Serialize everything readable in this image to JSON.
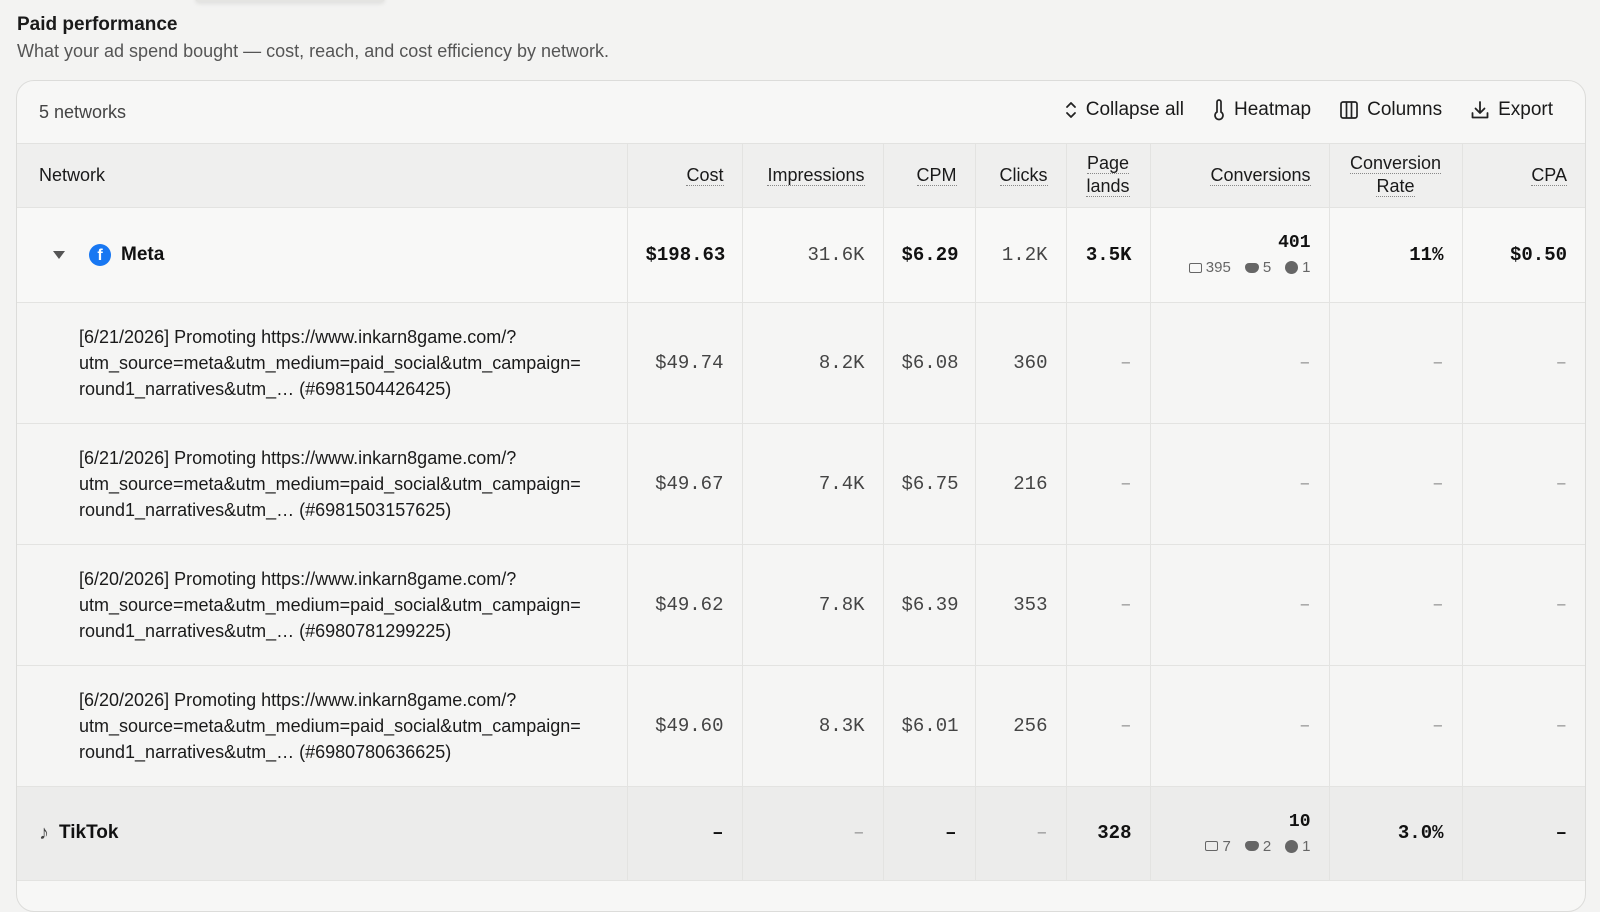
{
  "section": {
    "title": "Paid performance",
    "subtitle": "What your ad spend bought — cost, reach, and cost efficiency by network."
  },
  "toolbar": {
    "count": "5 networks",
    "collapse_label": "Collapse all",
    "heatmap_label": "Heatmap",
    "columns_label": "Columns",
    "export_label": "Export"
  },
  "columns": {
    "network": "Network",
    "cost": "Cost",
    "impressions": "Impressions",
    "cpm": "CPM",
    "clicks": "Clicks",
    "page_lands_1": "Page",
    "page_lands_2": "lands",
    "conversions": "Conversions",
    "conv_rate_1": "Conversion",
    "conv_rate_2": "Rate",
    "cpa": "CPA"
  },
  "meta": {
    "name": "Meta",
    "cost": "$198.63",
    "impressions": "31.6K",
    "cpm": "$6.29",
    "clicks": "1.2K",
    "page_lands": "3.5K",
    "conversions": "401",
    "conv_email": "395",
    "conv_discord": "5",
    "conv_threads": "1",
    "conv_rate": "11%",
    "cpa": "$0.50"
  },
  "campaigns": [
    {
      "line1": "[6/21/2026] Promoting https://www.inkarn8game.com/?",
      "line2": "utm_source=meta&utm_medium=paid_social&utm_campaign=",
      "line3": "round1_narratives&utm_… (#6981504426425)",
      "cost": "$49.74",
      "impressions": "8.2K",
      "cpm": "$6.08",
      "clicks": "360",
      "page_lands": "–",
      "conversions": "–",
      "conv_rate": "–",
      "cpa": "–"
    },
    {
      "line1": "[6/21/2026] Promoting https://www.inkarn8game.com/?",
      "line2": "utm_source=meta&utm_medium=paid_social&utm_campaign=",
      "line3": "round1_narratives&utm_… (#6981503157625)",
      "cost": "$49.67",
      "impressions": "7.4K",
      "cpm": "$6.75",
      "clicks": "216",
      "page_lands": "–",
      "conversions": "–",
      "conv_rate": "–",
      "cpa": "–"
    },
    {
      "line1": "[6/20/2026] Promoting https://www.inkarn8game.com/?",
      "line2": "utm_source=meta&utm_medium=paid_social&utm_campaign=",
      "line3": "round1_narratives&utm_… (#6980781299225)",
      "cost": "$49.62",
      "impressions": "7.8K",
      "cpm": "$6.39",
      "clicks": "353",
      "page_lands": "–",
      "conversions": "–",
      "conv_rate": "–",
      "cpa": "–"
    },
    {
      "line1": "[6/20/2026] Promoting https://www.inkarn8game.com/?",
      "line2": "utm_source=meta&utm_medium=paid_social&utm_campaign=",
      "line3": "round1_narratives&utm_… (#6980780636625)",
      "cost": "$49.60",
      "impressions": "8.3K",
      "cpm": "$6.01",
      "clicks": "256",
      "page_lands": "–",
      "conversions": "–",
      "conv_rate": "–",
      "cpa": "–"
    }
  ],
  "tiktok": {
    "name": "TikTok",
    "cost": "–",
    "impressions": "–",
    "cpm": "–",
    "clicks": "–",
    "page_lands": "328",
    "conversions": "10",
    "conv_email": "7",
    "conv_discord": "2",
    "conv_threads": "1",
    "conv_rate": "3.0%",
    "cpa": "–"
  },
  "icons": {
    "meta": "facebook-icon",
    "tiktok": "tiktok-icon",
    "collapse": "chevron-up-down-icon",
    "heatmap": "thermometer-icon",
    "columns": "columns-icon",
    "export": "download-icon"
  }
}
